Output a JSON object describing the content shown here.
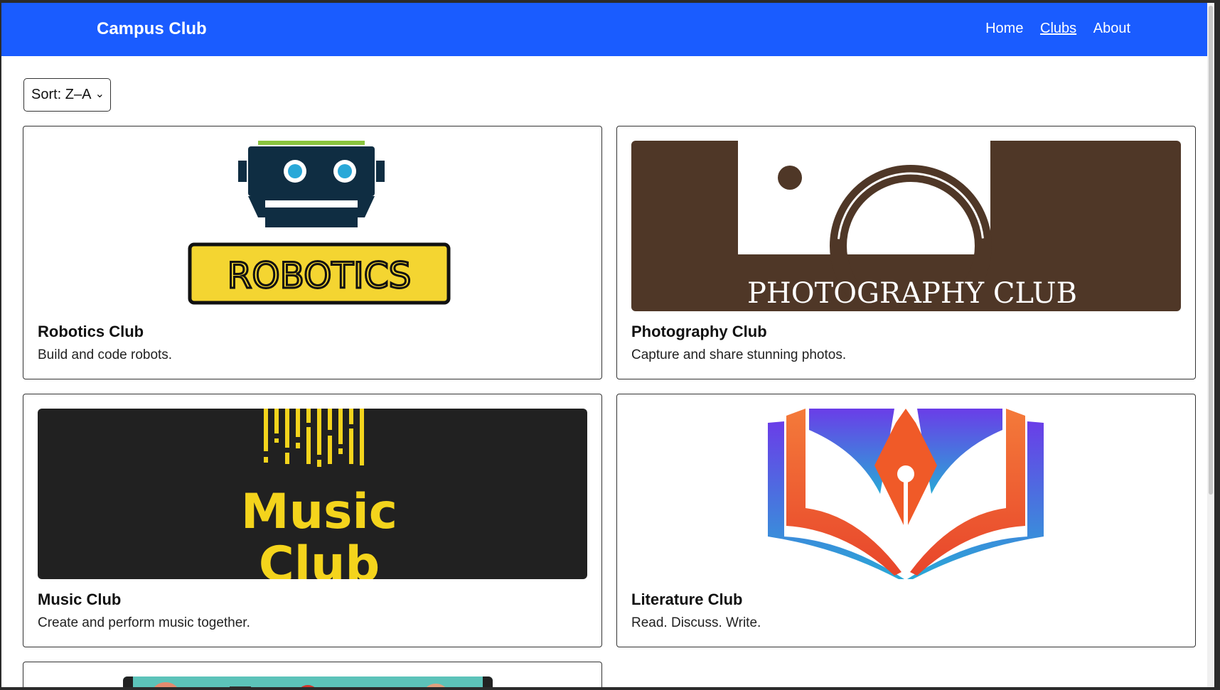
{
  "navbar": {
    "brand": "Campus Club",
    "links": [
      {
        "label": "Home"
      },
      {
        "label": "Clubs"
      },
      {
        "label": "About"
      }
    ]
  },
  "sort": {
    "selected": "Sort: Z–A"
  },
  "clubs": [
    {
      "title": "Robotics Club",
      "description": "Build and code robots.",
      "logo_text": "ROBOTICS"
    },
    {
      "title": "Photography Club",
      "description": "Capture and share stunning photos.",
      "logo_text": "PHOTOGRAPHY CLUB"
    },
    {
      "title": "Music Club",
      "description": "Create and perform music together.",
      "logo_text_1": "Music",
      "logo_text_2": "Club"
    },
    {
      "title": "Literature Club",
      "description": "Read. Discuss. Write."
    }
  ],
  "colors": {
    "navbar": "#1a5cff",
    "music_yellow": "#f4d41c",
    "photo_brown": "#4f3727"
  }
}
